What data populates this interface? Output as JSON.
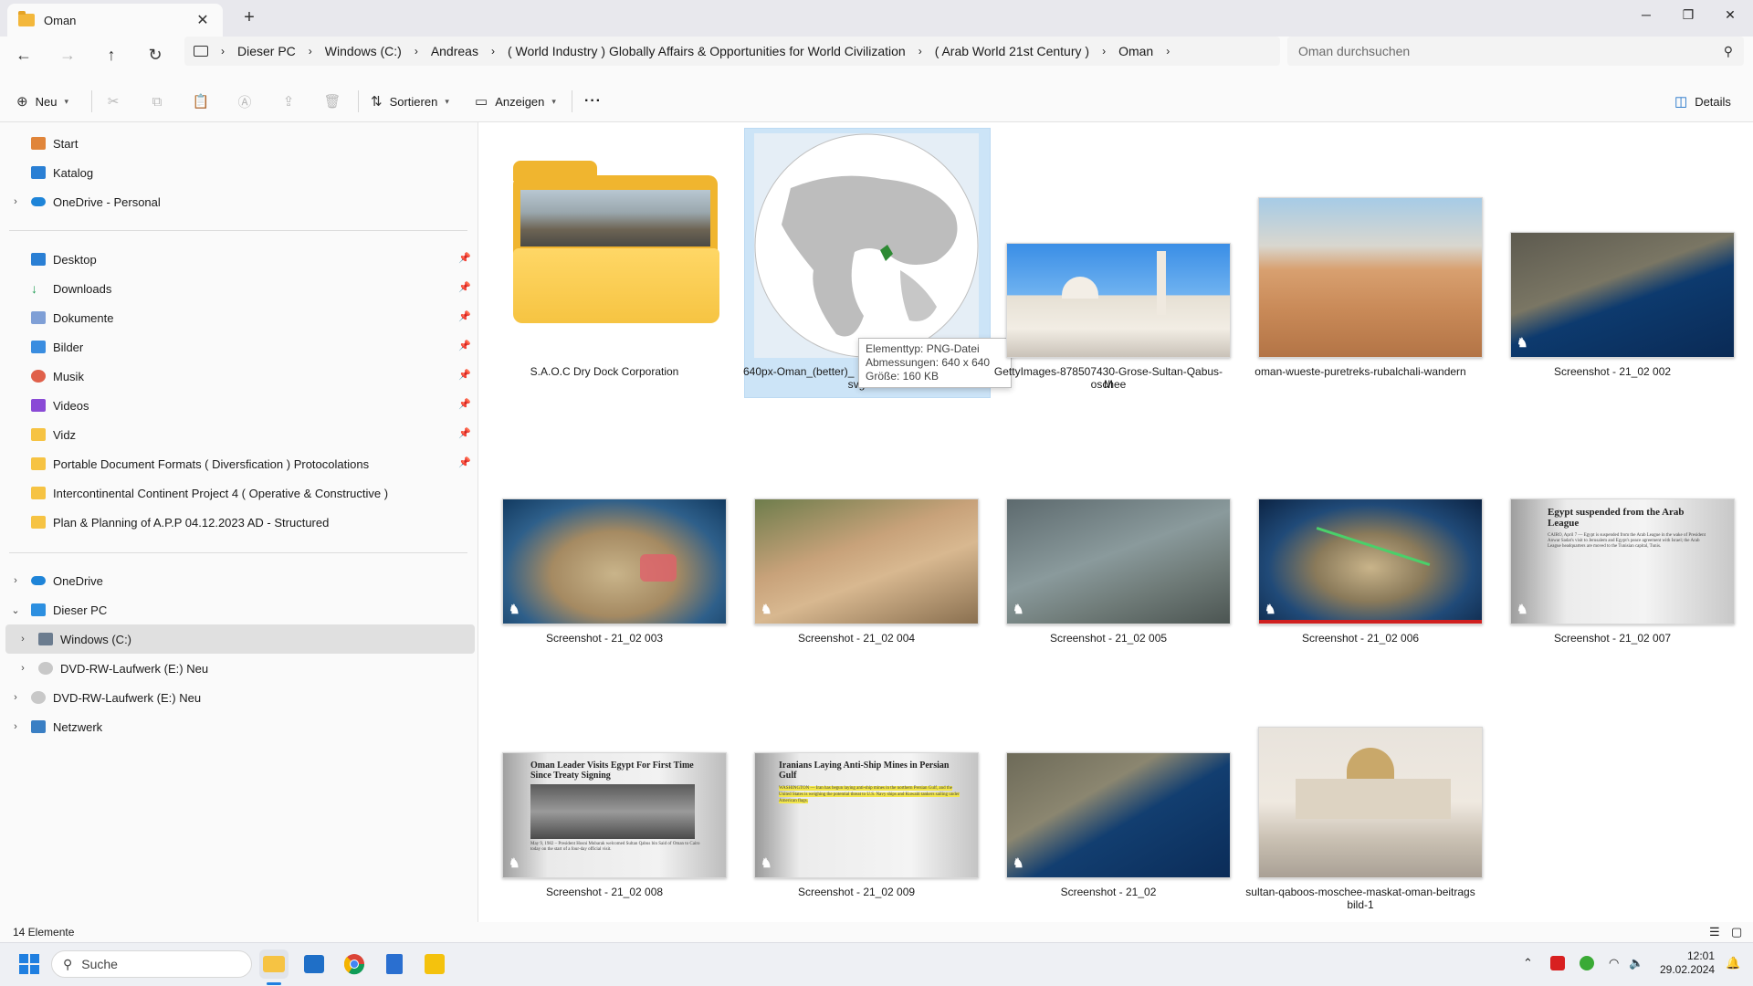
{
  "window": {
    "tab_title": "Oman",
    "new_tab_glyph": "+",
    "minimize_glyph": "─",
    "maximize_glyph": "❐",
    "close_glyph": "✕"
  },
  "address": {
    "crumbs": [
      "Dieser PC",
      "Windows (C:)",
      "Andreas",
      "( World Industry ) Globally Affairs & Opportunities for World Civilization",
      "( Arab World 21st Century )",
      "Oman"
    ],
    "search_placeholder": "Oman durchsuchen"
  },
  "commands": {
    "new": "Neu",
    "sort": "Sortieren",
    "view": "Anzeigen",
    "more": "···",
    "details": "Details"
  },
  "sidebar": {
    "top": [
      {
        "label": "Start",
        "icon": "home-icon"
      },
      {
        "label": "Katalog",
        "icon": "gallery-icon"
      },
      {
        "label": "OneDrive - Personal",
        "icon": "cloud-icon"
      }
    ],
    "pinned": [
      {
        "label": "Desktop"
      },
      {
        "label": "Downloads"
      },
      {
        "label": "Dokumente"
      },
      {
        "label": "Bilder"
      },
      {
        "label": "Musik"
      },
      {
        "label": "Videos"
      },
      {
        "label": "Vidz"
      },
      {
        "label": "Portable Document Formats ( Diversfication ) Protocolations"
      },
      {
        "label": "Intercontinental Continent Project 4 ( Operative & Constructive )"
      },
      {
        "label": "Plan  & Planning of A.P.P 04.12.2023 AD - Structured"
      }
    ],
    "bottom": [
      {
        "label": "OneDrive"
      },
      {
        "label": "Dieser PC"
      },
      {
        "label": "Windows (C:)"
      },
      {
        "label": "DVD-RW-Laufwerk (E:) Neu"
      },
      {
        "label": "DVD-RW-Laufwerk (E:) Neu"
      },
      {
        "label": "Netzwerk"
      }
    ]
  },
  "files": [
    {
      "name": "S.A.O.C Dry Dock Corporation"
    },
    {
      "name": "640px-Oman_(better)_",
      "name2": "svg"
    },
    {
      "name": "GettyImages-878507430-Grose-Sultan-Qabus-M",
      "name2": "oschee"
    },
    {
      "name": "oman-wueste-puretreks-rubalchali-wandern"
    },
    {
      "name": "Screenshot - 21_02 002"
    },
    {
      "name": "Screenshot - 21_02 003"
    },
    {
      "name": "Screenshot - 21_02 004"
    },
    {
      "name": "Screenshot - 21_02 005"
    },
    {
      "name": "Screenshot - 21_02 006"
    },
    {
      "name": "Screenshot - 21_02 007"
    },
    {
      "name": "Screenshot - 21_02 008"
    },
    {
      "name": "Screenshot - 21_02 009"
    },
    {
      "name": "Screenshot - 21_02"
    },
    {
      "name": "sultan-qaboos-moschee-maskat-oman-beitrags",
      "name2": "bild-1"
    }
  ],
  "tooltip": {
    "line1": "Elementtyp: PNG-Datei",
    "line2": "Abmessungen: 640 x 640",
    "line3": "Größe: 160 KB"
  },
  "thumb_text": {
    "egypt_title": "Egypt suspended from the Arab League",
    "egypt_body": "CAIRO, April 7 — Egypt is suspended from the Arab League in the wake of President Anwar Sadat's visit to Jerusalem and Egypt's peace agreement with Israel; the Arab League headquarters are moved to the Tunisian capital, Tunis.",
    "oman_title": "Oman Leader Visits Egypt For First Time Since Treaty Signing",
    "oman_body": "May 9, 1982 – President Hosni Mubarak welcomed Sultan Qabus bin Said of Oman to Cairo today on the start of a four-day official visit.",
    "iran_title": "Iranians Laying Anti-Ship Mines in Persian Gulf",
    "iran_body": "WASHINGTON — Iran has begun laying anti-ship mines in the northern Persian Gulf, and the United States is weighing the potential threat to U.S. Navy ships and Kuwaiti tankers sailing under American flags."
  },
  "status": {
    "count": "14 Elemente"
  },
  "taskbar": {
    "search": "Suche",
    "time": "12:01",
    "date": "29.02.2024"
  }
}
